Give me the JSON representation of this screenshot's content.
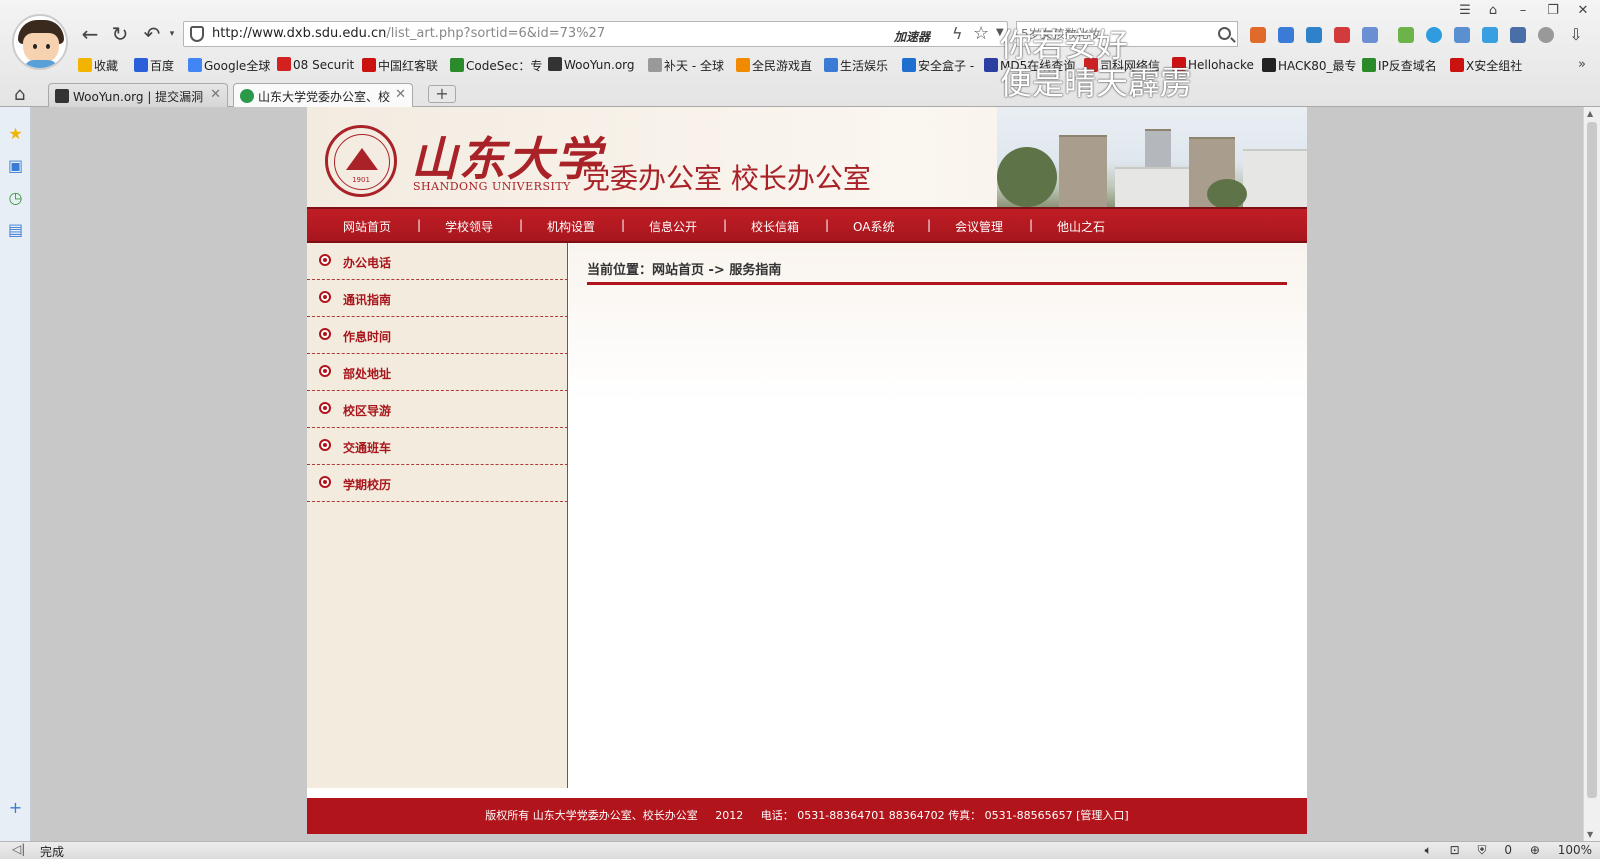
{
  "browser": {
    "address": {
      "host": "http://www.dxb.sdu.edu.cn",
      "path": "/list_art.php?sortid=6&id=73%27"
    },
    "accelerator_label": "加速器",
    "search_placeholder": "5岁女孩数化妆",
    "watermark_line1": "你若安好",
    "watermark_line2": "便是晴天霹雳",
    "bookmarks": [
      {
        "label": "收藏",
        "icon": "star-icon",
        "color": "#f2b400"
      },
      {
        "label": "百度",
        "icon": "baidu-icon",
        "color": "#2b5fd9"
      },
      {
        "label": "Google全球",
        "icon": "google-icon",
        "color": "#4285f4"
      },
      {
        "label": "08 Securit",
        "icon": "08sec-icon",
        "color": "#d32020"
      },
      {
        "label": "中国红客联",
        "icon": "honker-icon",
        "color": "#cc1111"
      },
      {
        "label": "CodeSec：专",
        "icon": "codesec-icon",
        "color": "#2b8a2b"
      },
      {
        "label": "WooYun.org",
        "icon": "wooyun-icon",
        "color": "#333333"
      },
      {
        "label": "补天 - 全球",
        "icon": "butian-icon",
        "color": "#999999"
      },
      {
        "label": "全民游戏直",
        "icon": "game-live-icon",
        "color": "#f28a00"
      },
      {
        "label": "生活娱乐",
        "icon": "entertainment-icon",
        "color": "#3a7bd5"
      },
      {
        "label": "安全盒子 -",
        "icon": "secbox-icon",
        "color": "#1f6fd0"
      },
      {
        "label": "MD5在线查询",
        "icon": "md5-icon",
        "color": "#2a3f9f"
      },
      {
        "label": "司科网络信",
        "icon": "sike-icon",
        "color": "#cc2222"
      },
      {
        "label": "Hellohacke",
        "icon": "hellohacker-icon",
        "color": "#cc1111"
      },
      {
        "label": "HACK80_最专",
        "icon": "hack80-icon",
        "color": "#222222"
      },
      {
        "label": "IP反查域名",
        "icon": "ip-lookup-icon",
        "color": "#2a8a2a"
      },
      {
        "label": "X安全组社",
        "icon": "x-sec-icon",
        "color": "#cc1111"
      }
    ],
    "tabs": [
      {
        "label": "WooYun.org | 提交漏洞",
        "active": false
      },
      {
        "label": "山东大学党委办公室、校",
        "active": true
      }
    ],
    "status_text": "完成",
    "status_right": {
      "block_count": "0",
      "zoom": "100%"
    }
  },
  "site": {
    "university_cn": "山东大学",
    "university_en": "SHANDONG UNIVERSITY",
    "seal_year": "1901",
    "office_title": "党委办公室 校长办公室",
    "nav": [
      "网站首页",
      "学校领导",
      "机构设置",
      "信息公开",
      "校长信箱",
      "OA系统",
      "会议管理",
      "他山之石"
    ],
    "menu": [
      "办公电话",
      "通讯指南",
      "作息时间",
      "部处地址",
      "校区导游",
      "交通班车",
      "学期校历"
    ],
    "breadcrumb": "当前位置：网站首页 -> 服务指南",
    "footer": {
      "copyright": "版权所有 山东大学党委办公室、校长办公室",
      "year": "2012",
      "phone": "电话：  0531-88364701   88364702",
      "fax": "传真：  0531-88565657",
      "admin_link": "[管理入口]"
    },
    "accent": "#b2141c"
  }
}
